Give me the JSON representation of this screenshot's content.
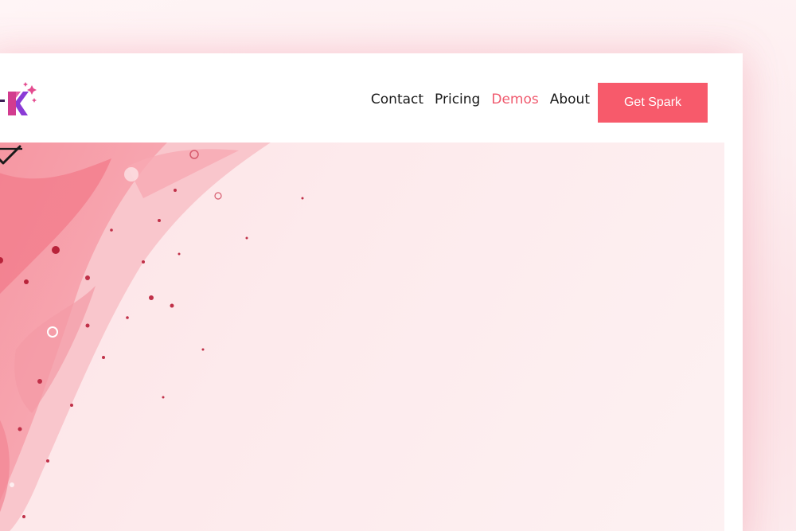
{
  "nav": {
    "links": [
      {
        "label": "Contact",
        "active": false
      },
      {
        "label": "Pricing",
        "active": false
      },
      {
        "label": "Demos",
        "active": true
      },
      {
        "label": "About",
        "active": false
      }
    ],
    "cta_label": "Get Spark"
  },
  "logo": {
    "letter": "K",
    "icon": "sparkle-logo-icon"
  },
  "hero": {
    "scroll_icon": "chevron-down-icon",
    "pointer_icon": "arrow-left-icon"
  },
  "colors": {
    "accent": "#f75a6b",
    "active_link": "#f05a6e",
    "text": "#1a1a1a",
    "background": "#fdeef0"
  }
}
